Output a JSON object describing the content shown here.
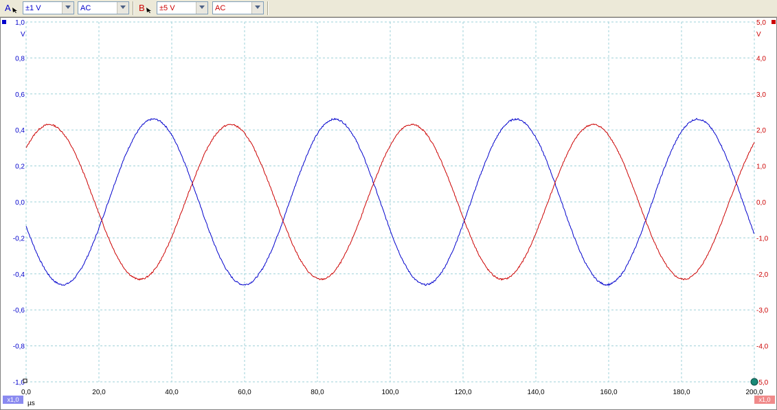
{
  "toolbar": {
    "channel_a": {
      "letter": "A",
      "range": "±1 V",
      "coupling": "AC",
      "color": "#0000cc"
    },
    "channel_b": {
      "letter": "B",
      "range": "±5 V",
      "coupling": "AC",
      "color": "#cc0000"
    }
  },
  "chart_data": {
    "type": "line",
    "x": {
      "label": "µs",
      "min": 0,
      "max": 200,
      "ticks": [
        "0,0",
        "20,0",
        "40,0",
        "60,0",
        "80,0",
        "100,0",
        "120,0",
        "140,0",
        "160,0",
        "180,0",
        "200,0"
      ]
    },
    "y_left": {
      "unit": "V",
      "min": -1.0,
      "max": 1.0,
      "ticks": [
        "1,0",
        "0,8",
        "0,6",
        "0,4",
        "0,2",
        "0,0",
        "-0,2",
        "-0,4",
        "-0,6",
        "-0,8",
        "-1,0"
      ]
    },
    "y_right": {
      "unit": "V",
      "min": -5.0,
      "max": 5.0,
      "ticks": [
        "5,0",
        "4,0",
        "3,0",
        "2,0",
        "1,0",
        "0,0",
        "-1,0",
        "-2,0",
        "-3,0",
        "-4,0",
        "-5,0"
      ]
    },
    "grid": true,
    "series": [
      {
        "channel": "A",
        "axis": "left",
        "color": "#0000cc",
        "amplitude": 0.46,
        "period": 49.8,
        "phase_deg": 197,
        "x_range": [
          0,
          200
        ]
      },
      {
        "channel": "B",
        "axis": "right",
        "color": "#cc0000",
        "amplitude": 2.15,
        "period": 49.8,
        "phase_deg": 44,
        "x_range": [
          0,
          200
        ]
      }
    ]
  },
  "badges": {
    "left": "x1,0",
    "right": "x1,0"
  },
  "colors": {
    "grid": "#9dd0d8",
    "marker_trigger": "#1a8a78"
  }
}
